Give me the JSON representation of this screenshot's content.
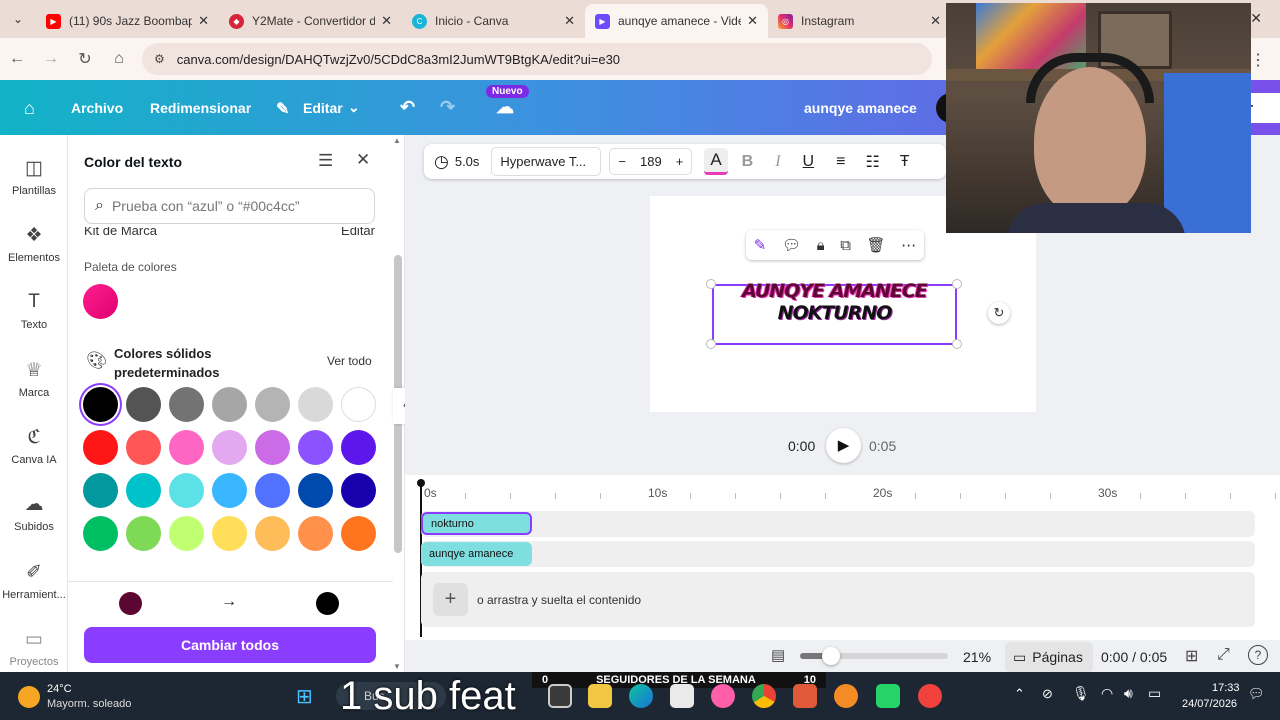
{
  "browser": {
    "tabs": [
      {
        "title": "(11) 90s Jazz Boombap",
        "color": "#ff0000",
        "active": false
      },
      {
        "title": "Y2Mate - Convertidor d",
        "color": "#d6243a",
        "active": false
      },
      {
        "title": "Inicio - Canva",
        "color": "#1bb4d8",
        "active": false
      },
      {
        "title": "aunqye amanece - Vide",
        "color": "#6c4bff",
        "active": true
      },
      {
        "title": "Instagram",
        "color": "#e1306c",
        "active": false
      }
    ],
    "url": "canva.com/design/DAHQTwzjZv0/5CDdC8a3mI2JumWT9BtgKA/edit?ui=e30"
  },
  "header": {
    "file": "Archivo",
    "resize": "Redimensionar",
    "edit": "Editar",
    "new_badge": "Nuevo",
    "design_title": "aunqye amanece",
    "share_partial": "r"
  },
  "sidebar": {
    "items": [
      {
        "label": "Plantillas",
        "icon": "template-icon"
      },
      {
        "label": "Elementos",
        "icon": "elements-icon"
      },
      {
        "label": "Texto",
        "icon": "text-icon"
      },
      {
        "label": "Marca",
        "icon": "brand-icon"
      },
      {
        "label": "Canva IA",
        "icon": "ai-icon"
      },
      {
        "label": "Subidos",
        "icon": "upload-icon"
      },
      {
        "label": "Herramient...",
        "icon": "tools-icon"
      },
      {
        "label": "Proyectos",
        "icon": "folder-icon"
      }
    ]
  },
  "panel": {
    "title": "Color del texto",
    "search_placeholder": "Prueba con “azul” o “#00c4cc”",
    "brand_kit": "Kit de Marca",
    "brand_edit": "Editar",
    "palette_label": "Paleta de colores",
    "solid_title_1": "Colores sólidos",
    "solid_title_2": "predeterminados",
    "see_all": "Ver todo",
    "swatches": [
      [
        "#000000",
        "#545454",
        "#737373",
        "#a6a6a6",
        "#b4b4b4",
        "#d9d9d9",
        "#ffffff"
      ],
      [
        "#ff1616",
        "#ff5757",
        "#ff66c4",
        "#e2a9f1",
        "#cb6ce6",
        "#8c52ff",
        "#5e17eb"
      ],
      [
        "#03989e",
        "#00c2cb",
        "#5ce1e6",
        "#38b6ff",
        "#5271ff",
        "#004aad",
        "#1800ad"
      ],
      [
        "#00bf63",
        "#7ed957",
        "#c1ff72",
        "#ffde59",
        "#ffbd59",
        "#ff914d",
        "#ff751f"
      ]
    ],
    "from_color": "#5c0632",
    "to_color": "#000000",
    "change_all": "Cambiar todos"
  },
  "toolbar": {
    "duration": "5.0s",
    "font": "Hyperwave T...",
    "font_size": "189"
  },
  "canvas": {
    "line1": "AUNQYE AMANECE",
    "line2": "NOKTURNO"
  },
  "playback": {
    "current": "0:00",
    "total": "0:05"
  },
  "timeline": {
    "ticks": [
      "0s",
      "10s",
      "20s",
      "30s"
    ],
    "clip1": "nokturno",
    "clip2": "aunqye amanece",
    "drop_hint": "o arrastra y suelta el contenido"
  },
  "footer": {
    "zoom": "21%",
    "zoom_fraction": 0.21,
    "pages": "Páginas",
    "time": "0:00 / 0:05"
  },
  "taskbar": {
    "temp": "24°C",
    "weather": "Mayorm. soleado",
    "search": "Bus",
    "overlay_text": "1 sub feat",
    "followers_label": "SEGUIDORES DE LA SEMANA",
    "followers_left": "0",
    "followers_right": "10",
    "clock": "17:33",
    "date": "24/07/2026"
  }
}
